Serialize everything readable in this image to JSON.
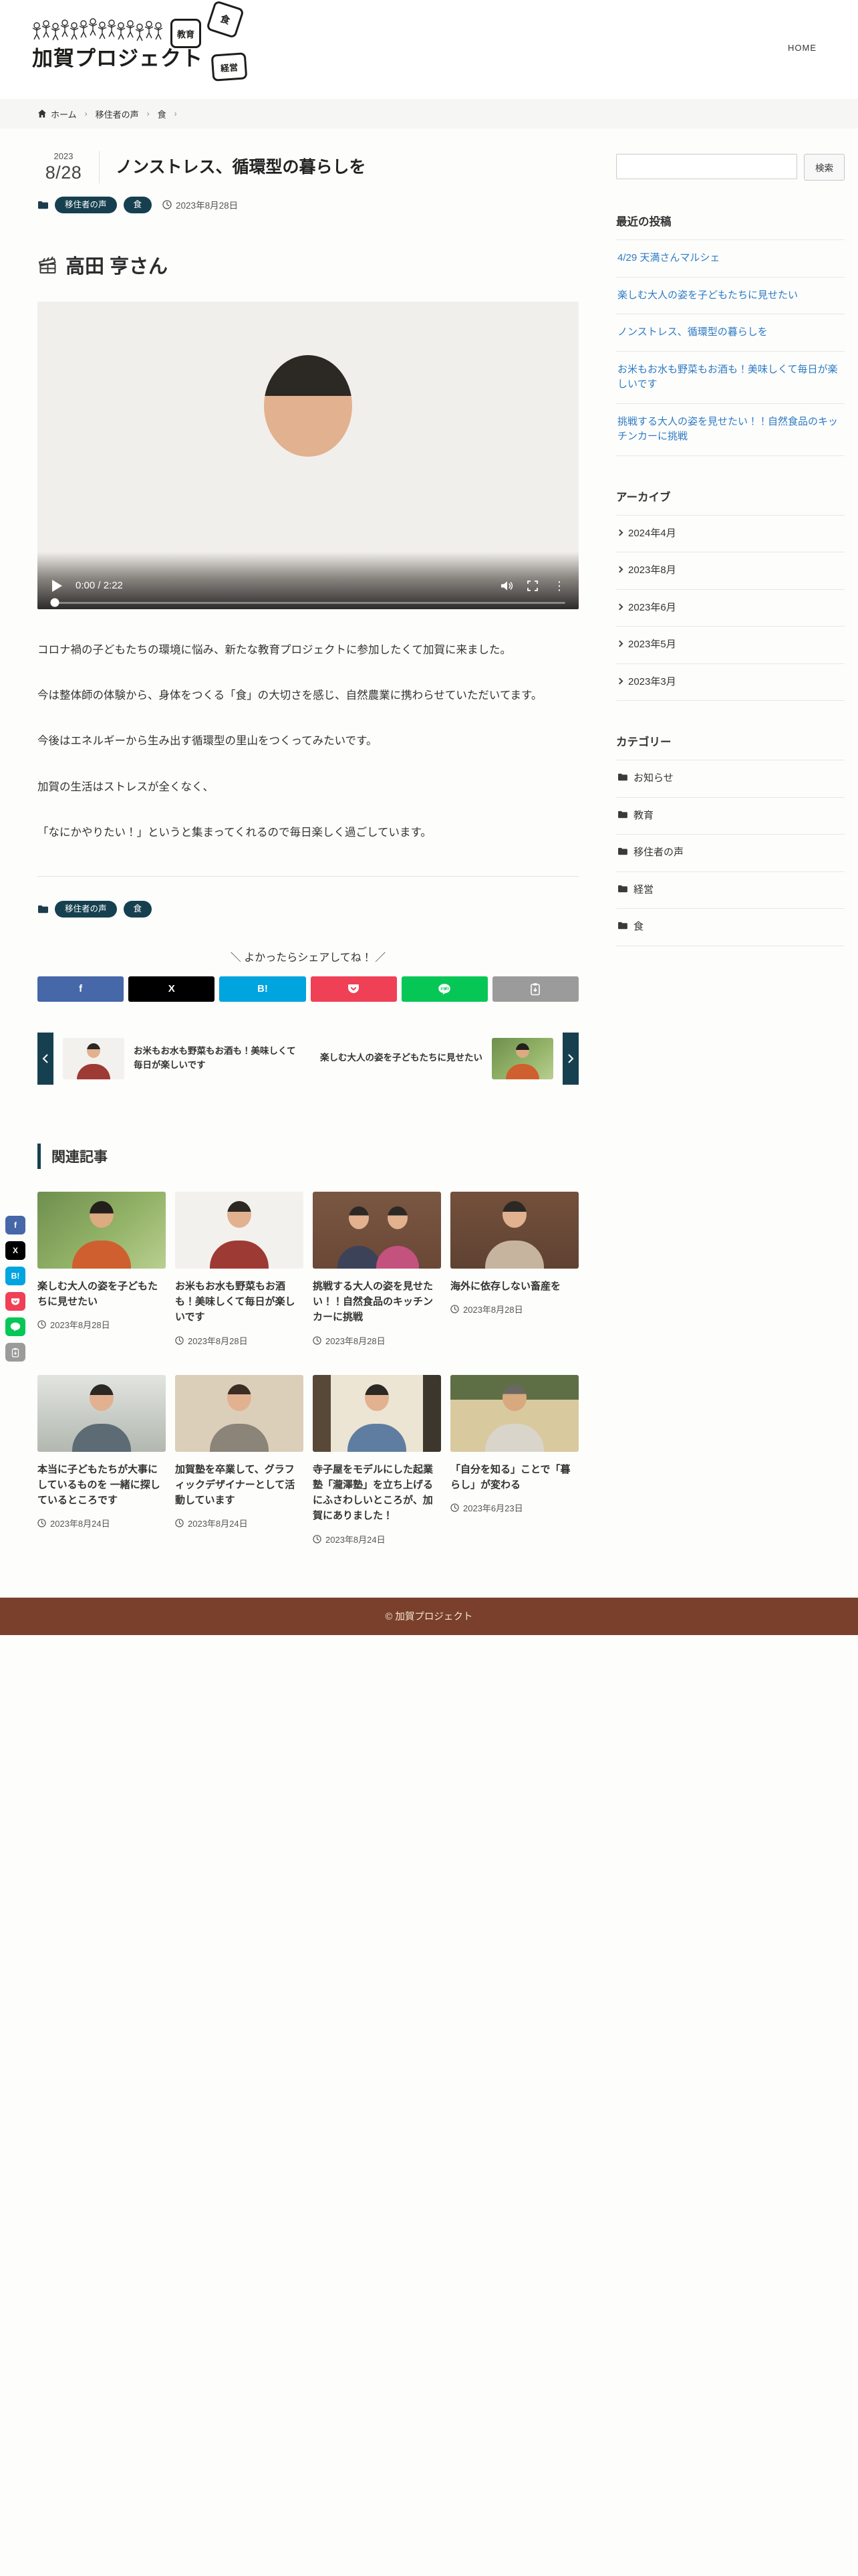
{
  "header": {
    "logo_title": "加賀プロジェクト",
    "logo_badge_education": "教育",
    "logo_badge_food": "食",
    "logo_badge_management": "経営",
    "nav_home": "HOME"
  },
  "breadcrumb": {
    "home": "ホーム",
    "category": "移住者の声",
    "subcategory": "食"
  },
  "post": {
    "date_year": "2023",
    "date_monthday": "8/28",
    "title": "ノンストレス、循環型の暮らしを",
    "category_voice": "移住者の声",
    "category_food": "食",
    "published_date": "2023年8月28日",
    "person_heading": "高田 亨さん",
    "video_time": "0:00 / 2:22",
    "paragraphs": {
      "p1": "コロナ禍の子どもたちの環境に悩み、新たな教育プロジェクトに参加したくて加賀に来ました。",
      "p2": "今は整体師の体験から、身体をつくる「食」の大切さを感じ、自然農業に携わらせていただいてます。",
      "p3": "今後はエネルギーから生み出す循環型の里山をつくってみたいです。",
      "p4": "加賀の生活はストレスが全くなく、",
      "p5": "「なにかやりたい！」というと集まってくれるので毎日楽しく過ごしています。"
    },
    "share_heading": "＼ よかったらシェアしてね！ ／",
    "share_glyphs": {
      "facebook": "f",
      "x": "X",
      "hatena": "B!"
    }
  },
  "prev_next": {
    "prev_title": "お米もお水も野菜もお酒も！美味しくて毎日が楽しいです",
    "next_title": "楽しむ大人の姿を子どもたちに見せたい"
  },
  "related": {
    "heading": "関連記事",
    "posts": [
      {
        "title": "楽しむ大人の姿を子どもたちに見せたい",
        "date": "2023年8月28日"
      },
      {
        "title": "お米もお水も野菜もお酒も！美味しくて毎日が楽しいです",
        "date": "2023年8月28日"
      },
      {
        "title": "挑戦する大人の姿を見せたい！！自然食品のキッチンカーに挑戦",
        "date": "2023年8月28日"
      },
      {
        "title": "海外に依存しない畜産を",
        "date": "2023年8月28日"
      },
      {
        "title": "本当に子どもたちが大事にしているものを 一緒に探しているところです",
        "date": "2023年8月24日"
      },
      {
        "title": "加賀塾を卒業して、グラフィックデザイナーとして活動しています",
        "date": "2023年8月24日"
      },
      {
        "title": "寺子屋をモデルにした起業塾「瀧澤塾」を立ち上げるにふさわしいところが、加賀にありました！",
        "date": "2023年8月24日"
      },
      {
        "title": "「自分を知る」ことで「暮らし」が変わる",
        "date": "2023年6月23日"
      }
    ]
  },
  "sidebar": {
    "search_button": "検索",
    "recent_heading": "最近の投稿",
    "recent": [
      "4/29 天満さんマルシェ",
      "楽しむ大人の姿を子どもたちに見せたい",
      "ノンストレス、循環型の暮らしを",
      "お米もお水も野菜もお酒も！美味しくて毎日が楽しいです",
      "挑戦する大人の姿を見せたい！！自然食品のキッチンカーに挑戦"
    ],
    "archive_heading": "アーカイブ",
    "archive": [
      "2024年4月",
      "2023年8月",
      "2023年6月",
      "2023年5月",
      "2023年3月"
    ],
    "categories_heading": "カテゴリー",
    "categories": [
      "お知らせ",
      "教育",
      "移住者の声",
      "経営",
      "食"
    ]
  },
  "footer": {
    "copyright": "© 加賀プロジェクト"
  },
  "colors": {
    "accent": "#16404f",
    "link": "#2e7bc4",
    "facebook": "#4667a8",
    "x": "#000000",
    "hatena": "#00a4de",
    "pocket": "#ef4056",
    "line": "#06c755",
    "copy": "#9b9b9b",
    "footer": "#7a402c"
  }
}
